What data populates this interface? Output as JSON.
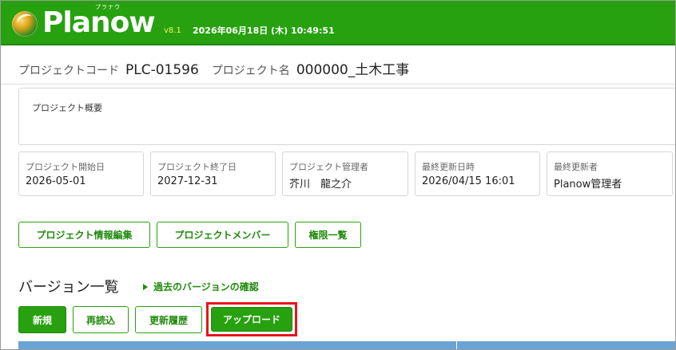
{
  "header": {
    "logo_text": "Planow",
    "logo_ruby": "プラナウ",
    "version": "v8.1",
    "datetime": "2026年06月18日 (木) 10:49:51"
  },
  "project": {
    "code_label": "プロジェクトコード",
    "code_value": "PLC-01596",
    "name_label": "プロジェクト名",
    "name_value": "000000_土木工事",
    "overview_label": "プロジェクト概要",
    "info": [
      {
        "label": "プロジェクト開始日",
        "value": "2026-05-01"
      },
      {
        "label": "プロジェクト終了日",
        "value": "2027-12-31"
      },
      {
        "label": "プロジェクト管理者",
        "value": "芥川　龍之介"
      },
      {
        "label": "最終更新日時",
        "value": "2026/04/15 16:01"
      },
      {
        "label": "最終更新者",
        "value": "Planow管理者"
      }
    ]
  },
  "actions": {
    "edit_info": "プロジェクト情報編集",
    "members": "プロジェクトメンバー",
    "permissions": "権限一覧"
  },
  "versions": {
    "title": "バージョン一覧",
    "past_link": "過去のバージョンの確認",
    "new_label": "新規",
    "reload_label": "再読込",
    "history_label": "更新履歴",
    "upload_label": "アップロード"
  },
  "colors": {
    "brand_green": "#27a10f",
    "highlight_red": "#e8141b",
    "table_header": "#6aa4d4"
  }
}
